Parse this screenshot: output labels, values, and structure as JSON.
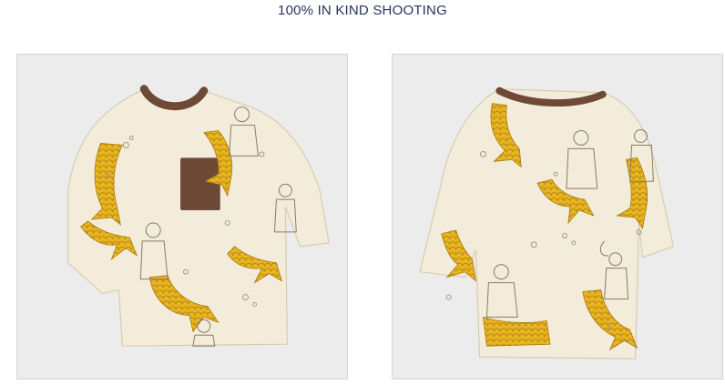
{
  "header": {
    "title": "100% IN KIND SHOOTING"
  },
  "photos": [
    {
      "subject": "shirt-front-photo"
    },
    {
      "subject": "shirt-back-photo"
    }
  ],
  "colors": {
    "title": "#26335e",
    "background": "#ececec",
    "fabric": "#f2ead6",
    "trim": "#6e4a36",
    "print_yellow": "#e8b520",
    "frame_border": "#d4d4d4"
  },
  "icons": [
    "mermaid-tail-icon",
    "merman-figure-icon",
    "bubble-icon"
  ]
}
